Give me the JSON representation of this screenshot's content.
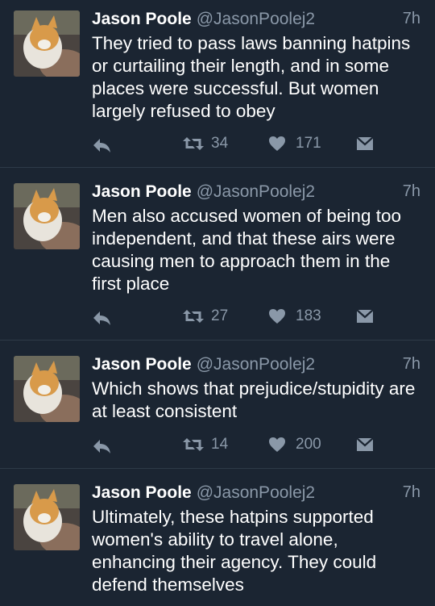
{
  "tweets": [
    {
      "name": "Jason Poole",
      "handle": "@JasonPoolej2",
      "time": "7h",
      "text": "They tried to pass laws banning hatpins or curtailing their length, and in some places were successful. But women largely refused to obey",
      "retweets": "34",
      "likes": "171"
    },
    {
      "name": "Jason Poole",
      "handle": "@JasonPoolej2",
      "time": "7h",
      "text": "Men also accused women of being too independent, and that these airs were causing men to approach them in the first place",
      "retweets": "27",
      "likes": "183"
    },
    {
      "name": "Jason Poole",
      "handle": "@JasonPoolej2",
      "time": "7h",
      "text": "Which shows that prejudice/stupidity are at least consistent",
      "retweets": "14",
      "likes": "200"
    },
    {
      "name": "Jason Poole",
      "handle": "@JasonPoolej2",
      "time": "7h",
      "text": "Ultimately, these hatpins supported women's ability to travel alone, enhancing their agency. They could defend themselves"
    }
  ],
  "icons": {
    "reply": "reply-icon",
    "retweet": "retweet-icon",
    "like": "heart-icon",
    "message": "direct-message-icon"
  },
  "colors": {
    "background": "#1b2532",
    "divider": "#2e3a48",
    "secondary_text": "#8a98a8",
    "primary_text": "#ffffff"
  }
}
